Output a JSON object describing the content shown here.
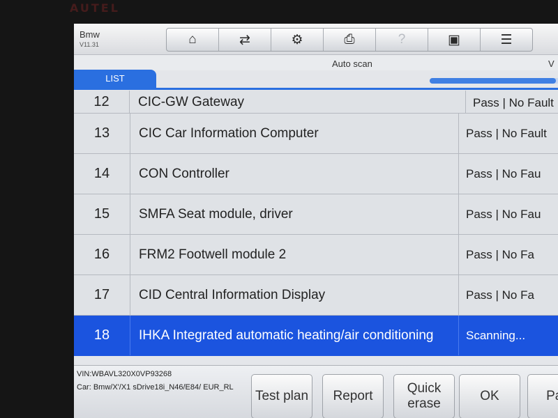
{
  "device": {
    "brand": "AUTEL"
  },
  "header": {
    "app_name": "Bmw",
    "version": "V11.31"
  },
  "toolbar": {
    "buttons": [
      {
        "icon": "home-icon",
        "glyph": "⌂"
      },
      {
        "icon": "vehicle-swap-icon",
        "glyph": "⇄"
      },
      {
        "icon": "settings-gear-icon",
        "glyph": "⚙"
      },
      {
        "icon": "printer-icon",
        "glyph": "⎙"
      },
      {
        "icon": "help-icon",
        "glyph": "?"
      },
      {
        "icon": "save-icon",
        "glyph": "▣"
      },
      {
        "icon": "message-icon",
        "glyph": "☰"
      }
    ]
  },
  "subheader": {
    "title": "Auto scan",
    "right_fragment": "V"
  },
  "tab": {
    "label": "LIST"
  },
  "scan_progress": {
    "fraction": 0.95
  },
  "modules": [
    {
      "num": "12",
      "name": "CIC-GW Gateway",
      "status": "Pass | No Fault"
    },
    {
      "num": "13",
      "name": "CIC Car Information Computer",
      "status": "Pass | No Fault"
    },
    {
      "num": "14",
      "name": "CON Controller",
      "status": "Pass | No Fau"
    },
    {
      "num": "15",
      "name": "SMFA Seat module, driver",
      "status": "Pass | No Fau"
    },
    {
      "num": "16",
      "name": "FRM2 Footwell module 2",
      "status": "Pass | No Fa"
    },
    {
      "num": "17",
      "name": "CID Central Information Display",
      "status": "Pass | No Fa"
    },
    {
      "num": "18",
      "name": "IHKA Integrated automatic heating/air conditioning",
      "status": "Scanning..."
    }
  ],
  "vehicle_info": {
    "vin": "VIN:WBAVL320X0VP93268",
    "car": "Car: Bmw/X'/X1 sDrive18i_N46/E84/ EUR_RL"
  },
  "buttons": {
    "test_plan": "Test plan",
    "report": "Report",
    "quick_erase": "Quick erase",
    "ok": "OK",
    "pause": "Pau"
  }
}
